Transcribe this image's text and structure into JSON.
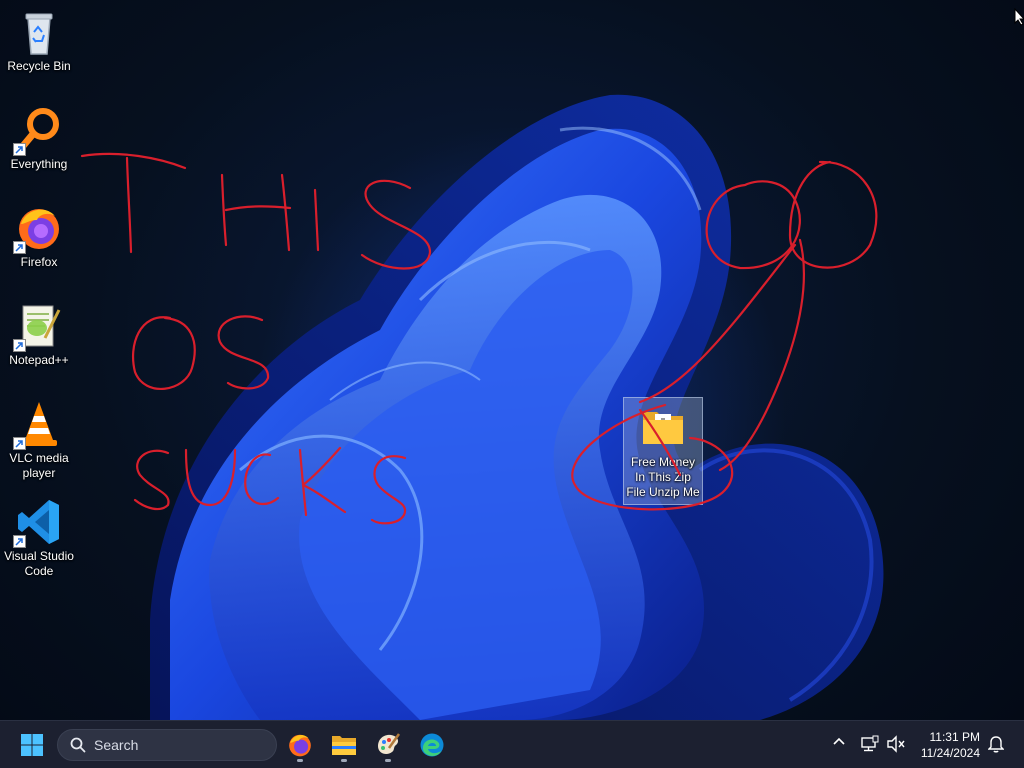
{
  "desktop": {
    "icons": [
      {
        "label": "Recycle Bin",
        "icon": "recycle-bin-icon"
      },
      {
        "label": "Everything",
        "icon": "everything-search-icon"
      },
      {
        "label": "Firefox",
        "icon": "firefox-icon"
      },
      {
        "label": "Notepad++",
        "icon": "notepad-plus-plus-icon"
      },
      {
        "label": "VLC media\nplayer",
        "icon": "vlc-icon"
      },
      {
        "label": "Visual Studio\nCode",
        "icon": "vscode-icon"
      }
    ],
    "zip_file": {
      "label": "Free Money\nIn This Zip\nFile Unzip Me",
      "icon": "zip-folder-icon"
    },
    "scribble_text": [
      "THIS",
      "OS",
      "SUCKS"
    ]
  },
  "taskbar": {
    "search_placeholder": "Search",
    "pinned": [
      "firefox-icon",
      "file-explorer-icon",
      "paint-icon",
      "edge-icon"
    ],
    "time": "11:31 PM",
    "date": "11/24/2024"
  },
  "colors": {
    "taskbar": "#1c2030",
    "accent": "#2b6fff",
    "scribble": "#d91f2c"
  }
}
